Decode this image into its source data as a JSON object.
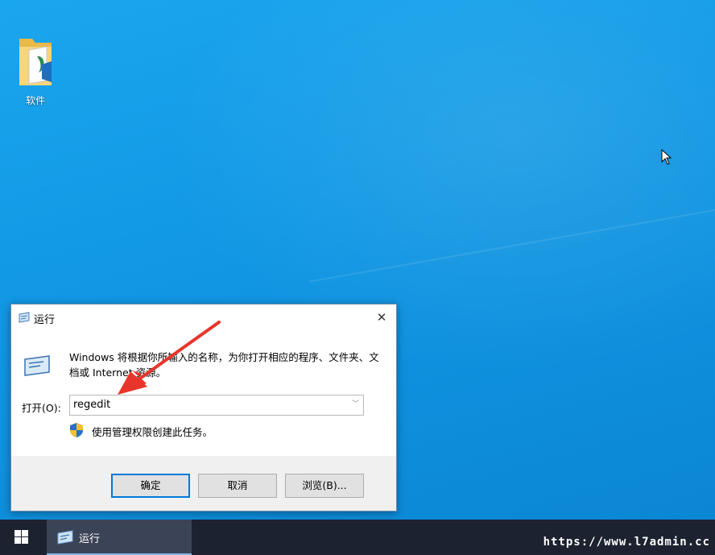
{
  "desktop": {
    "icons": [
      {
        "label": "软件",
        "icon": "folder-icon"
      }
    ]
  },
  "run_dialog": {
    "title": "运行",
    "description": "Windows 将根据你所输入的名称，为你打开相应的程序、文件夹、文档或 Internet 资源。",
    "open_label": "打开(O):",
    "input_value": "regedit",
    "admin_note": "使用管理权限创建此任务。",
    "buttons": {
      "ok": "确定",
      "cancel": "取消",
      "browse": "浏览(B)..."
    }
  },
  "taskbar": {
    "start_icon": "windows-logo-icon",
    "items": [
      {
        "label": "运行",
        "active": true
      }
    ]
  },
  "watermark": "https://www.l7admin.cc",
  "colors": {
    "desktop": "#1197e4",
    "taskbar": "#1c2230",
    "accent": "#0078d7",
    "annotation": "#e8352b"
  }
}
